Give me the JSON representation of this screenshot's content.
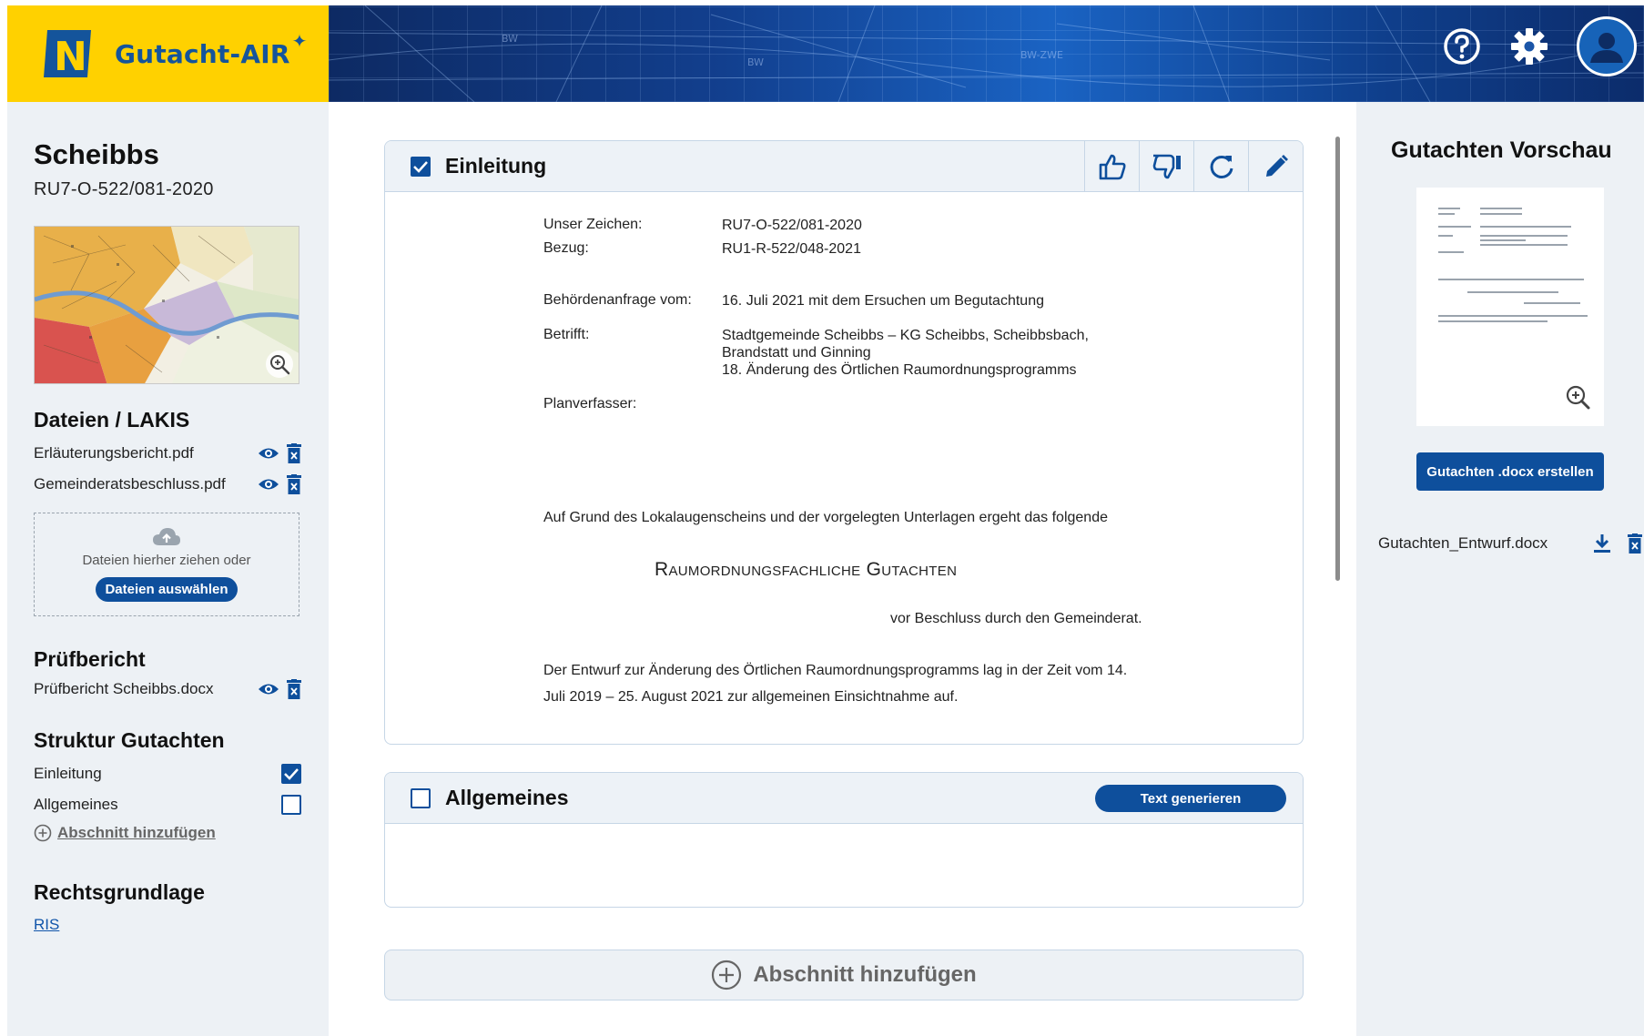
{
  "app": {
    "name": "Gutacht-AIR",
    "spark": "✦"
  },
  "header": {
    "help_icon": "help-circle-icon",
    "settings_icon": "gear-icon",
    "avatar_icon": "user-avatar-icon"
  },
  "sidebar": {
    "title": "Scheibbs",
    "reference": "RU7-O-522/081-2020",
    "files_heading": "Dateien / LAKIS",
    "files": [
      {
        "name": "Erläuterungsbericht.pdf"
      },
      {
        "name": "Gemeinderatsbeschluss.pdf"
      }
    ],
    "dropzone_text": "Dateien hierher ziehen oder",
    "dropzone_button": "Dateien auswählen",
    "pruef_heading": "Prüfbericht",
    "pruef_file": "Prüfbericht Scheibbs.docx",
    "structure_heading": "Struktur Gutachten",
    "structure": [
      {
        "label": "Einleitung",
        "checked": true
      },
      {
        "label": "Allgemeines",
        "checked": false
      }
    ],
    "add_section": "Abschnitt hinzufügen",
    "law_heading": "Rechtsgrundlage",
    "law_link": "RIS"
  },
  "sections": [
    {
      "title": "Einleitung",
      "checked": true,
      "tools": [
        "thumbs-up-icon",
        "thumbs-down-icon",
        "refresh-icon",
        "edit-pencil-icon"
      ],
      "doc": {
        "unser_zeichen_label": "Unser Zeichen:",
        "unser_zeichen": "RU7-O-522/081-2020",
        "bezug_label": "Bezug:",
        "bezug": "RU1-R-522/048-2021",
        "anfrage_label": "Behördenanfrage vom:",
        "anfrage": "16. Juli 2021 mit dem Ersuchen um Begutachtung",
        "betrifft_label": "Betrifft:",
        "betrifft_1": "Stadtgemeinde Scheibbs – KG Scheibbs, Scheibbsbach,",
        "betrifft_2": "Brandstatt und Ginning",
        "betrifft_3": "18. Änderung des Örtlichen Raumordnungsprogramms",
        "planverfasser_label": "Planverfasser:",
        "intro": "Auf Grund des Lokalaugenscheins und der vorgelegten Unterlagen ergeht das folgende",
        "heading": "Raumordnungsfachliche Gutachten",
        "beschluss": "vor Beschluss durch den Gemeinderat.",
        "entwurf_1": "Der Entwurf zur Änderung des Örtlichen Raumordnungsprogramms lag in der Zeit vom 14.",
        "entwurf_2": "Juli 2019 – 25. August 2021 zur allgemeinen Einsichtnahme auf."
      }
    },
    {
      "title": "Allgemeines",
      "checked": false,
      "generate_button": "Text generieren"
    }
  ],
  "add_section_button": "Abschnitt hinzufügen",
  "preview": {
    "title": "Gutachten Vorschau",
    "create_button": "Gutachten .docx erstellen",
    "draft_file": "Gutachten_Entwurf.docx"
  },
  "colors": {
    "brand_yellow": "#ffd100",
    "brand_blue": "#0e4f9c",
    "panel_bg": "#edf1f5"
  }
}
